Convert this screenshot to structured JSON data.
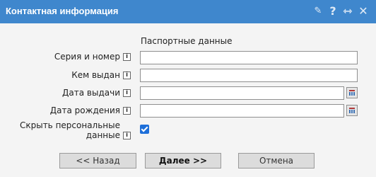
{
  "window": {
    "title": "Контактная информация"
  },
  "titlebar_icons": [
    {
      "name": "pin-icon",
      "glyph": "✎"
    },
    {
      "name": "help-icon",
      "glyph": "?"
    },
    {
      "name": "maximize-icon",
      "glyph": "⇿"
    },
    {
      "name": "close-icon",
      "glyph": "✕"
    }
  ],
  "form": {
    "section_title": "Паспортные данные",
    "fields": {
      "series_number": {
        "label": "Серия и номер",
        "value": ""
      },
      "issued_by": {
        "label": "Кем выдан",
        "value": ""
      },
      "issue_date": {
        "label": "Дата выдачи",
        "value": ""
      },
      "birth_date": {
        "label": "Дата рождения",
        "value": ""
      },
      "hide_personal": {
        "label_line1": "Скрыть персональные",
        "label_line2": "данные",
        "checked": true
      }
    },
    "info_glyph": "i"
  },
  "buttons": {
    "back": "<< Назад",
    "next": "Далее >>",
    "cancel": "Отмена"
  },
  "colors": {
    "titlebar": "#3f87cd",
    "checkbox": "#1e6fd9"
  }
}
